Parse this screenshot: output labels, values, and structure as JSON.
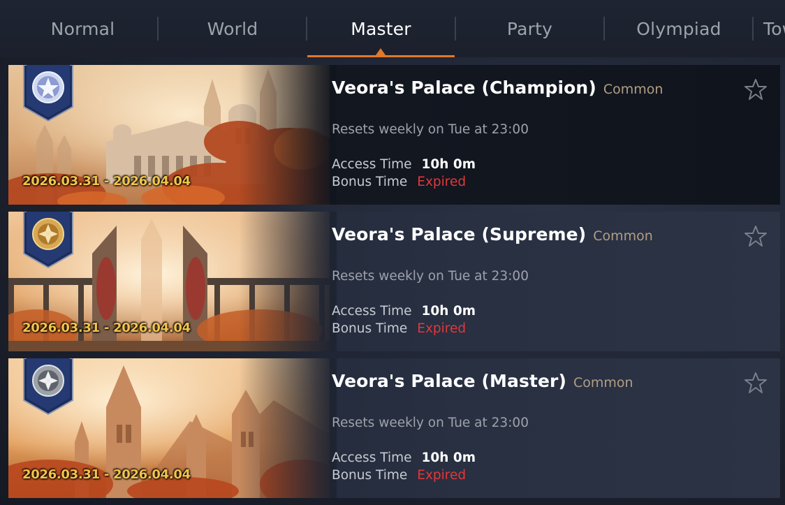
{
  "tabs": [
    {
      "label": "Normal",
      "active": false
    },
    {
      "label": "World",
      "active": false
    },
    {
      "label": "Master",
      "active": true
    },
    {
      "label": "Party",
      "active": false
    },
    {
      "label": "Olympiad",
      "active": false
    },
    {
      "label": "Tow",
      "active": false
    }
  ],
  "colors": {
    "accent": "#e2782a",
    "expired": "#e2383a",
    "rarity": "#b29e85",
    "date": "#f2c44a"
  },
  "cards": [
    {
      "title": "Veora's Palace (Champion)",
      "rarity": "Common",
      "date_range": "2026.03.31 - 2026.04.04",
      "reset_text": "Resets weekly on Tue at 23:00",
      "access_label": "Access Time",
      "access_value": "10h 0m",
      "bonus_label": "Bonus Time",
      "bonus_value": "Expired",
      "badge_icon": "champion-emblem-icon",
      "favorite": false
    },
    {
      "title": "Veora's Palace (Supreme)",
      "rarity": "Common",
      "date_range": "2026.03.31 - 2026.04.04",
      "reset_text": "Resets weekly on Tue at 23:00",
      "access_label": "Access Time",
      "access_value": "10h 0m",
      "bonus_label": "Bonus Time",
      "bonus_value": "Expired",
      "badge_icon": "supreme-emblem-icon",
      "favorite": false
    },
    {
      "title": "Veora's Palace (Master)",
      "rarity": "Common",
      "date_range": "2026.03.31 - 2026.04.04",
      "reset_text": "Resets weekly on Tue at 23:00",
      "access_label": "Access Time",
      "access_value": "10h 0m",
      "bonus_label": "Bonus Time",
      "bonus_value": "Expired",
      "badge_icon": "master-emblem-icon",
      "favorite": false
    }
  ]
}
